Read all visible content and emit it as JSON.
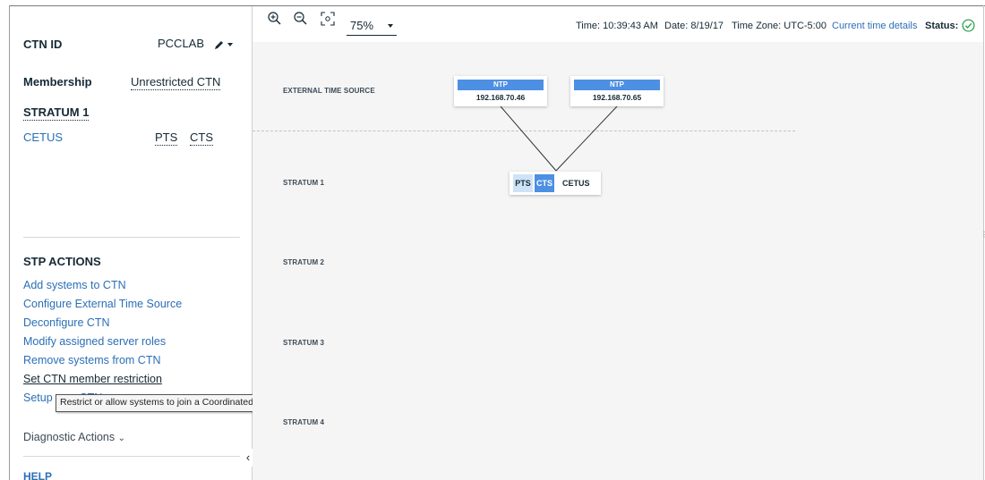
{
  "ctn": {
    "id_label": "CTN ID",
    "id_value": "PCCLAB",
    "membership_label": "Membership",
    "membership_value": "Unrestricted CTN",
    "stratum1_heading": "STRATUM 1",
    "system_name": "CETUS",
    "role_pts": "PTS",
    "role_cts": "CTS"
  },
  "stp_actions": {
    "heading": "STP ACTIONS",
    "items": [
      "Add systems to CTN",
      "Configure External Time Source",
      "Deconfigure CTN",
      "Modify assigned server roles",
      "Remove systems from CTN",
      "Set CTN member restriction",
      "Setup new CTN"
    ],
    "tooltip": "Restrict or allow systems to join a Coordinated Timing Network.",
    "diagnostic": "Diagnostic Actions",
    "help": "HELP"
  },
  "toolbar": {
    "zoom": "75%",
    "time": "Time: 10:39:43 AM",
    "date": "Date: 8/19/17",
    "timezone": "Time Zone: UTC-5:00",
    "details_link": "Current time details",
    "status_label": "Status:"
  },
  "topology": {
    "layers": [
      "EXTERNAL TIME SOURCE",
      "STRATUM 1",
      "STRATUM 2",
      "STRATUM 3",
      "STRATUM 4"
    ],
    "ntp_servers": [
      {
        "type": "NTP",
        "ip": "192.168.70.46"
      },
      {
        "type": "NTP",
        "ip": "192.168.70.65"
      }
    ],
    "system": {
      "pts": "PTS",
      "cts": "CTS",
      "name": "CETUS"
    }
  },
  "colors": {
    "link": "#2b6fb6",
    "accent": "#4d8fe3",
    "status_ok": "#2ea44f"
  }
}
